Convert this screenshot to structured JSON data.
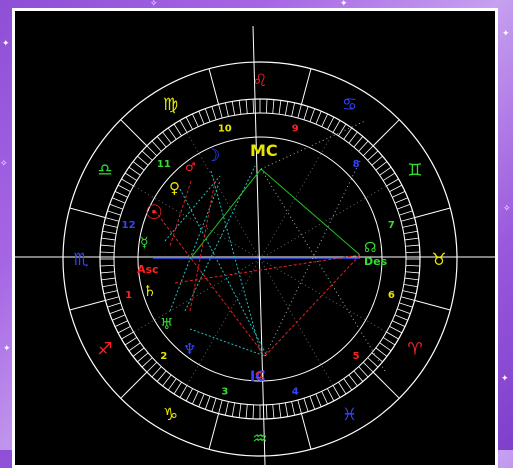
{
  "colors": {
    "background_gradient": [
      "#8f4fd6",
      "#c7a0f0",
      "#7e3fcc"
    ],
    "frame": "#ffffff",
    "chart_background": "#000000",
    "wheel_lines": "#ffffff",
    "house_number_red": "#ff2222",
    "house_number_yellow": "#e6e600",
    "house_number_blue": "#3344ff",
    "house_number_green": "#33dd33",
    "aspect_red": "#e02020",
    "aspect_green": "#20c020",
    "aspect_cyan": "#20c0c0",
    "aspect_blue": "#3355ff"
  },
  "zodiac_signs": [
    {
      "icon": "leo-icon",
      "glyph": "♌",
      "color": "#ff2222",
      "angle": 90
    },
    {
      "icon": "cancer-icon",
      "glyph": "♋",
      "color": "#3344ff",
      "angle": 60
    },
    {
      "icon": "gemini-icon",
      "glyph": "♊",
      "color": "#33dd33",
      "angle": 30
    },
    {
      "icon": "taurus-icon",
      "glyph": "♉",
      "color": "#e6e600",
      "angle": 0
    },
    {
      "icon": "aries-icon",
      "glyph": "♈",
      "color": "#ff2222",
      "angle": -30
    },
    {
      "icon": "pisces-icon",
      "glyph": "♓",
      "color": "#3344ff",
      "angle": -60
    },
    {
      "icon": "aquarius-icon",
      "glyph": "♒",
      "color": "#33dd33",
      "angle": -90
    },
    {
      "icon": "capricorn-icon",
      "glyph": "♑",
      "color": "#e6e600",
      "angle": -120
    },
    {
      "icon": "sagittarius-icon",
      "glyph": "♐",
      "color": "#ff2222",
      "angle": -150
    },
    {
      "icon": "scorpio-icon",
      "glyph": "♏",
      "color": "#3344ff",
      "angle": 180
    },
    {
      "icon": "libra-icon",
      "glyph": "♎",
      "color": "#33dd33",
      "angle": 150
    },
    {
      "icon": "virgo-icon",
      "glyph": "♍",
      "color": "#e6e600",
      "angle": 120
    }
  ],
  "houses": [
    {
      "label": "1",
      "color": "#ff2222"
    },
    {
      "label": "2",
      "color": "#e6e600"
    },
    {
      "label": "3",
      "color": "#33dd33"
    },
    {
      "label": "4",
      "color": "#3344ff"
    },
    {
      "label": "5",
      "color": "#ff2222"
    },
    {
      "label": "6",
      "color": "#e6e600"
    },
    {
      "label": "7",
      "color": "#33dd33"
    },
    {
      "label": "8",
      "color": "#3344ff"
    },
    {
      "label": "9",
      "color": "#ff2222"
    },
    {
      "label": "10",
      "color": "#e6e600"
    },
    {
      "label": "11",
      "color": "#33dd33"
    },
    {
      "label": "12",
      "color": "#3344ff"
    }
  ],
  "angles": {
    "mc": {
      "label": "MC",
      "color": "#e6e600"
    },
    "ic": {
      "label": "IC",
      "color": "#3344ff"
    },
    "asc": {
      "label": "Asc",
      "color": "#ff2222"
    },
    "des": {
      "label": "Des",
      "color": "#33dd33"
    }
  },
  "planets": [
    {
      "name": "moon",
      "icon": "moon-icon",
      "glyph": "☽",
      "color": "#3344ff"
    },
    {
      "name": "mars",
      "icon": "mars-icon",
      "glyph": "♂",
      "color": "#ff2222"
    },
    {
      "name": "venus",
      "icon": "venus-icon",
      "glyph": "♀",
      "color": "#e6e600"
    },
    {
      "name": "sun",
      "icon": "sun-icon",
      "glyph": "☉",
      "color": "#ff2222"
    },
    {
      "name": "mercury",
      "icon": "mercury-icon",
      "glyph": "☿",
      "color": "#33dd33"
    },
    {
      "name": "saturn",
      "icon": "saturn-icon",
      "glyph": "♄",
      "color": "#e6e600"
    },
    {
      "name": "uranus",
      "icon": "uranus-icon",
      "glyph": "♅",
      "color": "#33dd33"
    },
    {
      "name": "neptune",
      "icon": "neptune-icon",
      "glyph": "♆",
      "color": "#3344ff"
    },
    {
      "name": "jupiter",
      "icon": "jupiter-icon",
      "glyph": "♃",
      "color": "#ff2222"
    },
    {
      "name": "north-node",
      "icon": "north-node-icon",
      "glyph": "☊",
      "color": "#33dd33"
    }
  ]
}
